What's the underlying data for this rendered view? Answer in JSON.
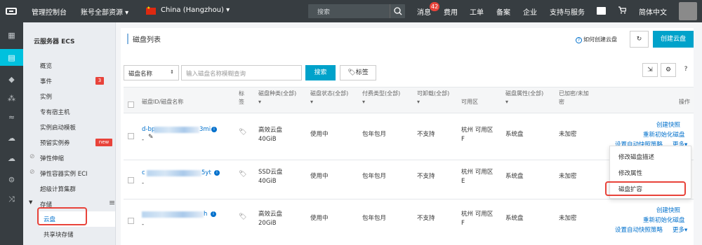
{
  "topbar": {
    "console": "管理控制台",
    "account": "账号全部资源 ▾",
    "region": "China (Hangzhou) ▾",
    "search_placeholder": "搜索",
    "messages": "消息",
    "message_count": "42",
    "billing": "费用",
    "tickets": "工单",
    "icp": "备案",
    "enterprise": "企业",
    "support": "支持与服务",
    "language": "简体中文"
  },
  "sidebar": {
    "title": "云服务器 ECS",
    "items": [
      {
        "label": "概览"
      },
      {
        "label": "事件",
        "count": "3"
      },
      {
        "label": "实例"
      },
      {
        "label": "专有宿主机"
      },
      {
        "label": "实例启动模板"
      },
      {
        "label": "预留实例券",
        "tag": "new"
      },
      {
        "label": "弹性伸缩"
      },
      {
        "label": "弹性容器实例 ECI"
      },
      {
        "label": "超级计算集群"
      },
      {
        "label": "存储"
      },
      {
        "label": "云盘"
      },
      {
        "label": "共享块存储"
      }
    ]
  },
  "page": {
    "title": "磁盘列表",
    "help_link": "如何创建云盘",
    "create_button": "创建云盘",
    "filter_select": "磁盘名称",
    "search_placeholder": "输入磁盘名称模糊查询",
    "search_button": "搜索",
    "tag_button": "标签"
  },
  "table": {
    "headers": {
      "id": "磁盘ID/磁盘名称",
      "tag": "标\n签",
      "type": "磁盘种类(全部)\n▾",
      "status": "磁盘状态(全部)\n▾",
      "pay": "付费类型(全部)\n▾",
      "detach": "可卸载(全部)\n▾",
      "zone": "可用区",
      "attr": "磁盘属性(全部)\n▾",
      "encrypted": "已加密/未加\n密",
      "ops": "操作"
    },
    "rows": [
      {
        "id_prefix": "d-bp",
        "id_suffix": "3mi",
        "name": "-",
        "type": "高效云盘\n40GiB",
        "status": "使用中",
        "pay": "包年包月",
        "detach": "不支持",
        "zone": "杭州 可用区\nF",
        "attr": "系统盘",
        "encrypted": "未加密",
        "op1": "创建快照",
        "op2": "重新初始化磁盘",
        "op3": "设置自动快照策略",
        "more": "更多▾"
      },
      {
        "id_prefix": "c",
        "id_suffix": "5yt",
        "name": "-",
        "type": "SSD云盘\n40GiB",
        "status": "使用中",
        "pay": "包年包月",
        "detach": "不支持",
        "zone": "杭州 可用区\nE",
        "attr": "系统盘",
        "encrypted": "未加密"
      },
      {
        "id_prefix": "",
        "id_suffix": "h",
        "name": "-",
        "type": "高效云盘\n20GiB",
        "status": "使用中",
        "pay": "包年包月",
        "detach": "不支持",
        "zone": "杭州 可用区\nF",
        "attr": "系统盘",
        "encrypted": "未加密",
        "op1": "创建快照",
        "op2": "重新初始化磁盘",
        "op3": "设置自动快照策略",
        "more": "更多▾"
      }
    ]
  },
  "dropdown": {
    "items": [
      "修改磁盘描述",
      "修改属性",
      "磁盘扩容"
    ]
  },
  "colors": {
    "accent": "#00a2ca",
    "highlight": "#e8433a",
    "link": "#0070cc"
  }
}
